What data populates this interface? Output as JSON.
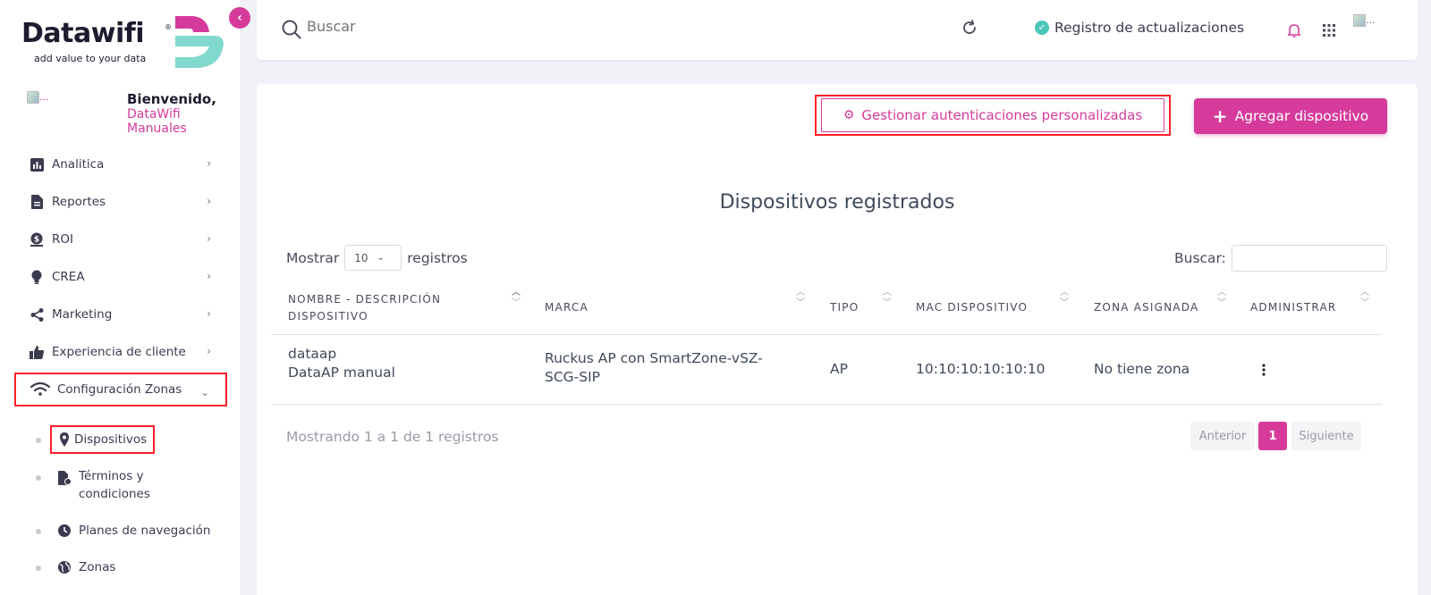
{
  "brand": {
    "logo_text": "Datawifi",
    "logo_reg": "®",
    "tagline": "add value to your data",
    "accent_color": "#d63b9b",
    "secondary_color": "#4bc8b8"
  },
  "sidebar": {
    "collapse_icon": "chevron-left-icon",
    "avatar_alt": "...",
    "welcome_title": "Bienvenido,",
    "welcome_name": "DataWifi Manuales",
    "items": [
      {
        "label": "Analitica",
        "icon": "chart-icon"
      },
      {
        "label": "Reportes",
        "icon": "file-icon"
      },
      {
        "label": "ROI",
        "icon": "dollar-icon"
      },
      {
        "label": "CREA",
        "icon": "lightbulb-icon"
      },
      {
        "label": "Marketing",
        "icon": "share-icon"
      },
      {
        "label": "Experiencia de cliente",
        "icon": "thumbs-up-icon"
      },
      {
        "label": "Configuración Zonas",
        "icon": "wifi-icon",
        "expanded": true
      }
    ],
    "subitems": [
      {
        "label": "Dispositivos",
        "icon": "map-pin-icon",
        "active": true
      },
      {
        "label": "Términos y condiciones",
        "icon": "file-check-icon"
      },
      {
        "label": "Planes de navegación",
        "icon": "clock-icon"
      },
      {
        "label": "Zonas",
        "icon": "globe-icon"
      }
    ]
  },
  "topbar": {
    "search_placeholder": "Buscar",
    "updates_label": "Registro de actualizaciones",
    "profile_alt": "..."
  },
  "main": {
    "manage_button": "Gestionar autenticaciones personalizadas",
    "add_button": "Agregar dispositivo",
    "title": "Dispositivos registrados",
    "show_prefix": "Mostrar",
    "show_value": "10",
    "show_suffix": "registros",
    "search_label": "Buscar:",
    "table": {
      "headers": [
        "NOMBRE - DESCRIPCIÓN DISPOSITIVO",
        "MARCA",
        "TIPO",
        "MAC DISPOSITIVO",
        "ZONA ASIGNADA",
        "ADMINISTRAR"
      ],
      "rows": [
        {
          "name": "dataap",
          "description": "DataAP manual",
          "brand": "Ruckus AP con SmartZone-vSZ-SCG-SIP",
          "type": "AP",
          "mac": "10:10:10:10:10:10",
          "zone": "No tiene zona"
        }
      ]
    },
    "footer_info": "Mostrando 1 a 1 de 1 registros",
    "pagination": {
      "prev": "Anterior",
      "current": "1",
      "next": "Siguiente"
    }
  }
}
